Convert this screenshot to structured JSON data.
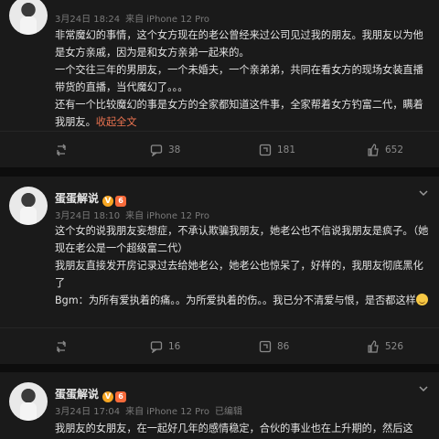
{
  "posts": [
    {
      "author": "",
      "meta_date": "3月24日 18:24",
      "meta_source": "来自 iPhone 12 Pro",
      "edited": "",
      "paragraphs": [
        "非常魔幻的事情，这个女方现在的老公曾经来过公司见过我的朋友。我朋友以为他是女方亲戚，因为是和女方亲弟一起来的。",
        "一个交往三年的男朋友，一个未婚夫，一个亲弟弟，共同在看女方的现场女装直播带货的直播，当代魔幻了。。。",
        "还有一个比较魔幻的事是女方的全家都知道这件事，全家帮着女方钓富二代，瞒着我朋友。"
      ],
      "expand_label": "收起全文",
      "reposts": "",
      "comments": "38",
      "likes_mid": "181",
      "likes": "652"
    },
    {
      "author": "蛋蛋解说",
      "meta_date": "3月24日 18:10",
      "meta_source": "来自 iPhone 12 Pro",
      "edited": "",
      "paragraphs": [
        "这个女的说我朋友妄想症，不承认欺骗我朋友，她老公也不信说我朋友是疯子。（她现在老公是一个超级富二代）",
        "我朋友直接发开房记录过去给她老公，她老公也惊呆了，好样的，我朋友彻底黑化了",
        "Bgm：为所有爱执着的痛。。为所爱执着的伤。。我已分不清爱与恨，是否都这样"
      ],
      "reposts": "",
      "comments": "16",
      "likes_mid": "86",
      "likes": "526"
    },
    {
      "author": "蛋蛋解说",
      "meta_date": "3月24日 17:04",
      "meta_source": "来自 iPhone 12 Pro",
      "edited": "已编辑",
      "paragraphs": [
        "我朋友的女朋友，在一起好几年的感情稳定，合伙的事业也在上升期的，然后这"
      ]
    }
  ],
  "badges": {
    "v": "V",
    "lv": "6"
  },
  "colors": {
    "accent": "#eb7350",
    "background": "#1a1a1a"
  }
}
